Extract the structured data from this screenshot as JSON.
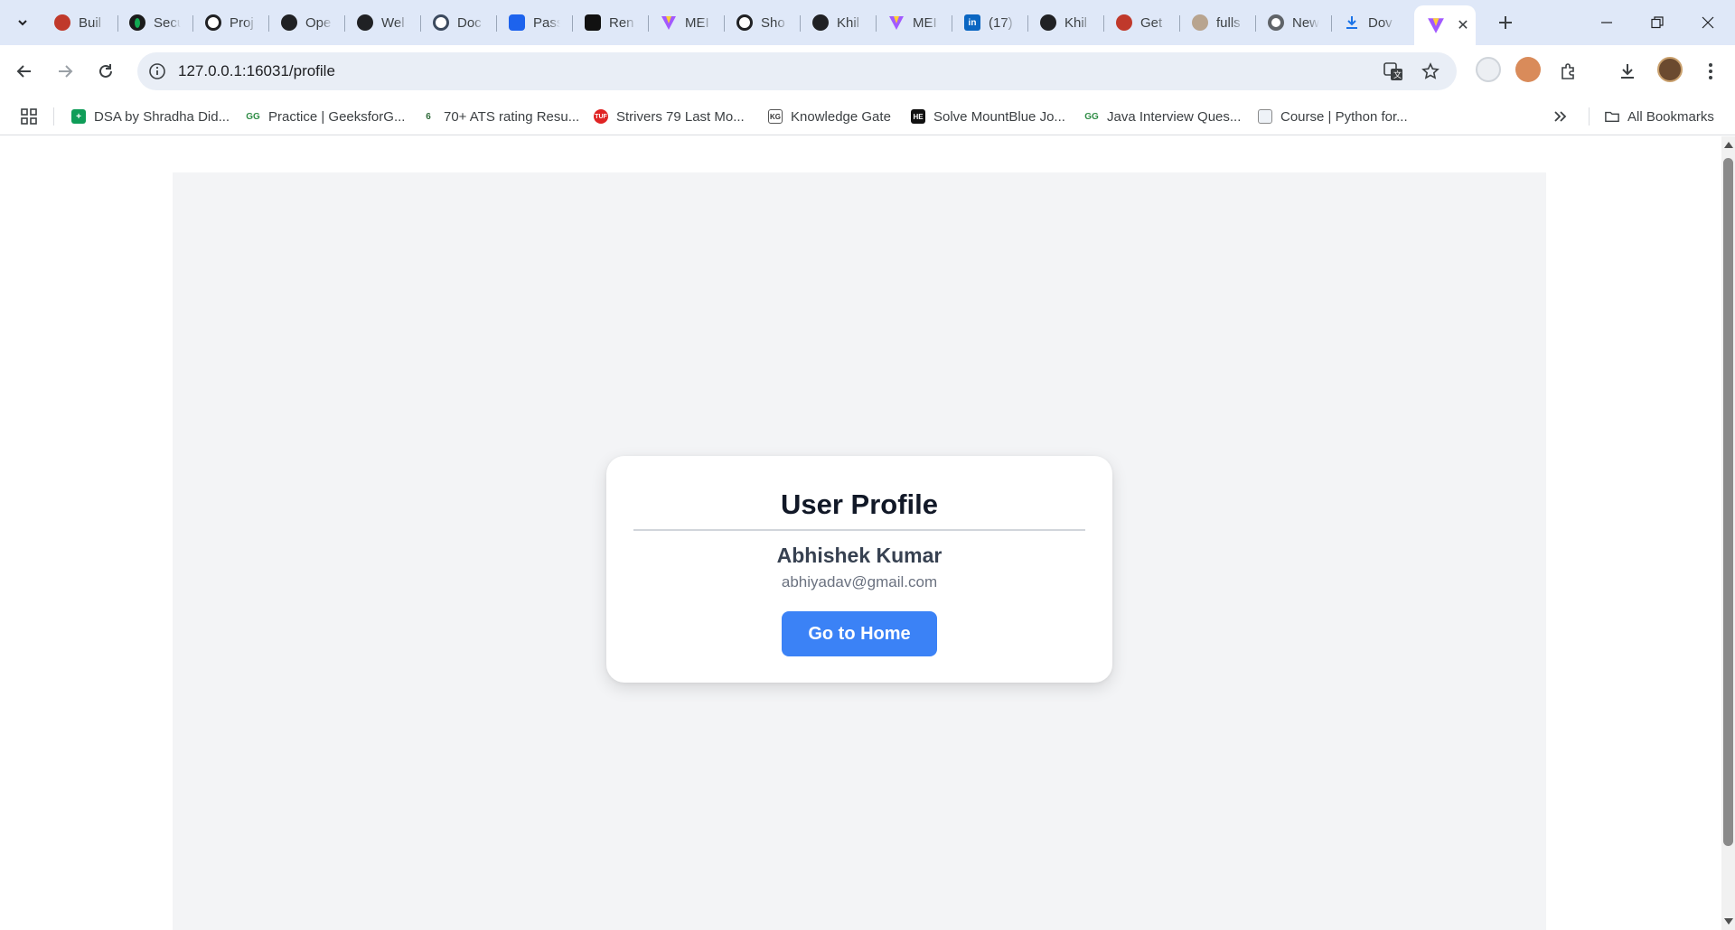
{
  "browser": {
    "tabs": [
      {
        "title": "Buil",
        "icon": "avatar-red-icon"
      },
      {
        "title": "Secu",
        "icon": "mongodb-leaf-icon"
      },
      {
        "title": "Proj",
        "icon": "openai-icon"
      },
      {
        "title": "Ope",
        "icon": "openai-dark-icon"
      },
      {
        "title": "Wel",
        "icon": "github-icon"
      },
      {
        "title": "Doc",
        "icon": "docs-globe-icon"
      },
      {
        "title": "Pass",
        "icon": "docker-whale-icon"
      },
      {
        "title": "Ren",
        "icon": "render-icon"
      },
      {
        "title": "MEI",
        "icon": "vite-icon"
      },
      {
        "title": "Sho",
        "icon": "openai-icon"
      },
      {
        "title": "Khil",
        "icon": "github-icon"
      },
      {
        "title": "MEI",
        "icon": "vite-icon"
      },
      {
        "title": "(17)",
        "icon": "linkedin-icon"
      },
      {
        "title": "Khil",
        "icon": "github-icon"
      },
      {
        "title": "Get",
        "icon": "avatar-red-icon"
      },
      {
        "title": "fulls",
        "icon": "person-illustration-icon"
      },
      {
        "title": "New",
        "icon": "chrome-icon"
      },
      {
        "title": "Dov",
        "icon": "download-icon"
      }
    ],
    "active_tab_icon": "vite-icon",
    "url": "127.0.0.1:16031/profile",
    "bookmarks": [
      {
        "label": "DSA by Shradha Did...",
        "icon": "google-sheets-icon"
      },
      {
        "label": "Practice | GeeksforG...",
        "icon": "gfg-icon"
      },
      {
        "label": "70+ ATS rating Resu...",
        "icon": "resume-icon"
      },
      {
        "label": "Strivers 79 Last Mo...",
        "icon": "tuf-icon"
      },
      {
        "label": "Knowledge Gate",
        "icon": "kg-icon"
      },
      {
        "label": "Solve MountBlue Jo...",
        "icon": "hackerearth-icon"
      },
      {
        "label": "Java Interview Ques...",
        "icon": "gfg-icon"
      },
      {
        "label": "Course | Python for...",
        "icon": "course-icon"
      }
    ],
    "all_bookmarks_label": "All Bookmarks"
  },
  "profile": {
    "title": "User Profile",
    "name": "Abhishek Kumar",
    "email": "abhiyadav@gmail.com",
    "home_button": "Go to Home"
  },
  "colors": {
    "accent": "#3b82f6",
    "page_background": "#f3f4f6",
    "card": "#ffffff"
  }
}
